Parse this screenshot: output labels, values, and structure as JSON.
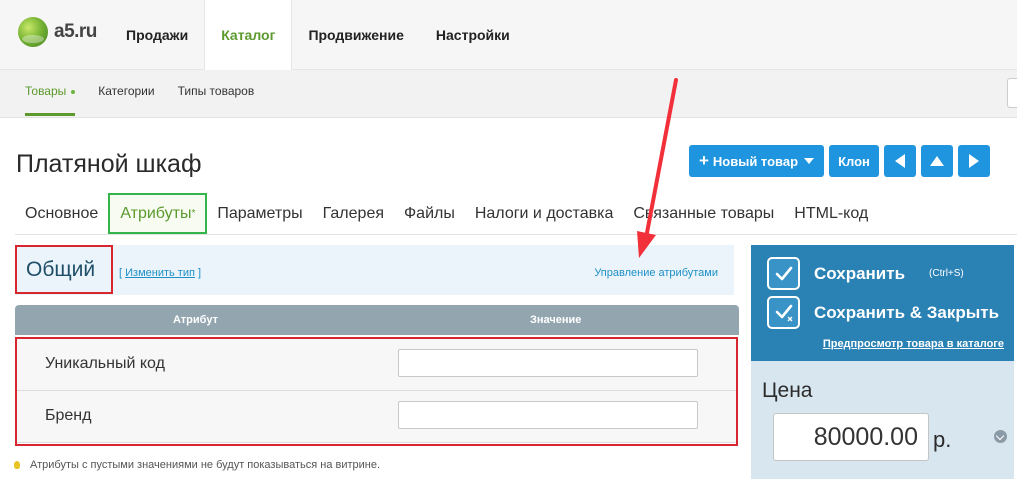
{
  "logo": {
    "text": "a5.ru"
  },
  "topnav": {
    "items": [
      {
        "label": "Продажи"
      },
      {
        "label": "Каталог",
        "active": true
      },
      {
        "label": "Продвижение"
      },
      {
        "label": "Настройки"
      }
    ]
  },
  "subnav": {
    "items": [
      {
        "label": "Товары",
        "active": true
      },
      {
        "label": "Категории"
      },
      {
        "label": "Типы товаров"
      }
    ]
  },
  "page": {
    "title": "Платяной шкаф"
  },
  "toolbar": {
    "new_label": "Новый товар",
    "clone_label": "Клон",
    "color": "#1f94df"
  },
  "tabs": [
    {
      "label": "Основное"
    },
    {
      "label": "Атрибуты",
      "active": true,
      "mark": "*"
    },
    {
      "label": "Параметры"
    },
    {
      "label": "Галерея"
    },
    {
      "label": "Файлы"
    },
    {
      "label": "Налоги и доставка"
    },
    {
      "label": "Связанные товары"
    },
    {
      "label": "HTML-код"
    }
  ],
  "group": {
    "title": "Общий",
    "change_bracket_open": "[",
    "change_label": "Изменить тип",
    "change_bracket_close": "]",
    "manage_label": "Управление атрибутами"
  },
  "table": {
    "col_attr": "Атрибут",
    "col_value": "Значение",
    "rows": [
      {
        "label": "Уникальный код",
        "value": ""
      },
      {
        "label": "Бренд",
        "value": ""
      }
    ]
  },
  "hint": {
    "text": "Атрибуты с пустыми значениями не будут показываться на витрине."
  },
  "save": {
    "save_label": "Сохранить",
    "save_hotkey": "(Ctrl+S)",
    "save_close_label": "Сохранить & Закрыть",
    "preview_label": "Предпросмотр товара в каталоге",
    "color": "#2a81b4"
  },
  "price": {
    "label": "Цена",
    "value": "80000.00",
    "currency": "р."
  },
  "colors": {
    "accent_green": "#5c9a2e",
    "highlight_red": "#d8262f",
    "tab_highlight": "#33b54a"
  }
}
